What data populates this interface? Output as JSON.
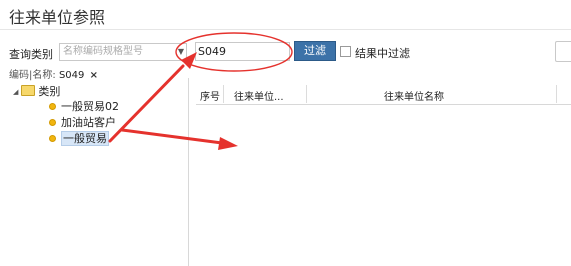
{
  "page": {
    "title": "往来单位参照"
  },
  "toolbar": {
    "query_label": "查询类别",
    "category_placeholder": "名称编码规格型号",
    "filter_value": "S049",
    "filter_button": "过滤",
    "result_filter_label": "结果中过滤"
  },
  "crumb": {
    "fields": "编码|名称:",
    "value": "S049",
    "close": "×"
  },
  "tree": {
    "root": "类别",
    "items": [
      {
        "label": "一般贸易02",
        "selected": false
      },
      {
        "label": "加油站客户",
        "selected": false
      },
      {
        "label": "一般贸易",
        "selected": true
      }
    ]
  },
  "grid": {
    "columns": [
      "序号",
      "往来单位...",
      "往来单位名称"
    ]
  },
  "colors": {
    "accent": "#3c72a8",
    "annotation": "#e5322d"
  }
}
